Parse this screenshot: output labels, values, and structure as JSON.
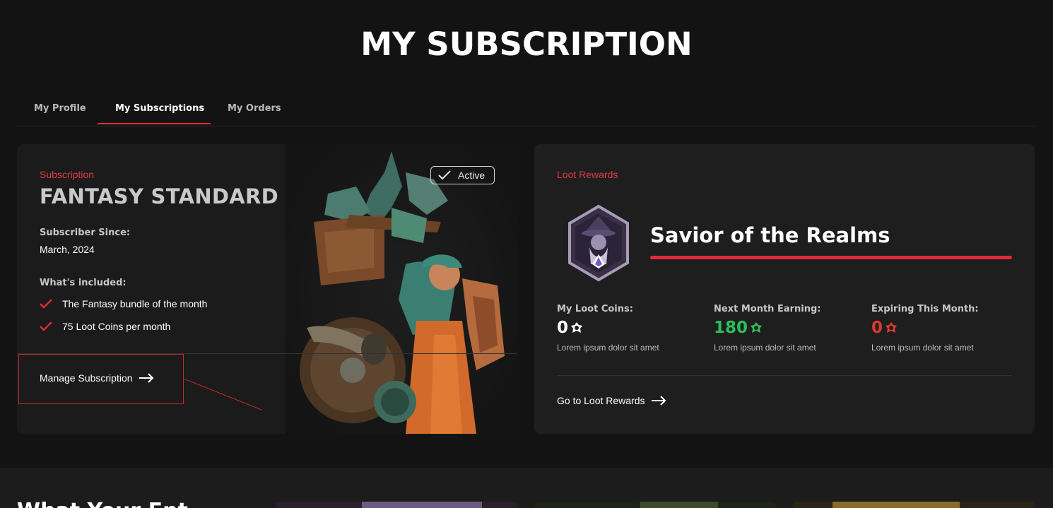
{
  "page": {
    "title": "MY SUBSCRIPTION"
  },
  "tabs": [
    {
      "label": "My Profile"
    },
    {
      "label": "My Subscriptions"
    },
    {
      "label": "My Orders"
    }
  ],
  "subscription": {
    "eyebrow": "Subscription",
    "name": "FANTASY STANDARD",
    "status": "Active",
    "since_label": "Subscriber Since:",
    "since_value": "March, 2024",
    "included_label": "What's included:",
    "included": [
      "The Fantasy bundle of the month",
      "75 Loot Coins per month"
    ],
    "manage_label": "Manage Subscription"
  },
  "loot": {
    "eyebrow": "Loot Rewards",
    "rank": "Savior of the Realms",
    "stats": [
      {
        "label": "My Loot Coins:",
        "value": "0",
        "desc": "Lorem ipsum dolor sit amet",
        "color": "#ffffff"
      },
      {
        "label": "Next Month Earning:",
        "value": "180",
        "desc": "Lorem ipsum dolor sit amet",
        "color": "#2bbf5a"
      },
      {
        "label": "Expiring This Month:",
        "value": "0",
        "desc": "Lorem ipsum dolor sit amet",
        "color": "#d93a30"
      }
    ],
    "link_label": "Go to Loot Rewards"
  },
  "bottom": {
    "heading": "What Your Ent"
  },
  "colors": {
    "accent": "#e22a3a",
    "background": "#131313",
    "card": "#1e1e1e"
  }
}
